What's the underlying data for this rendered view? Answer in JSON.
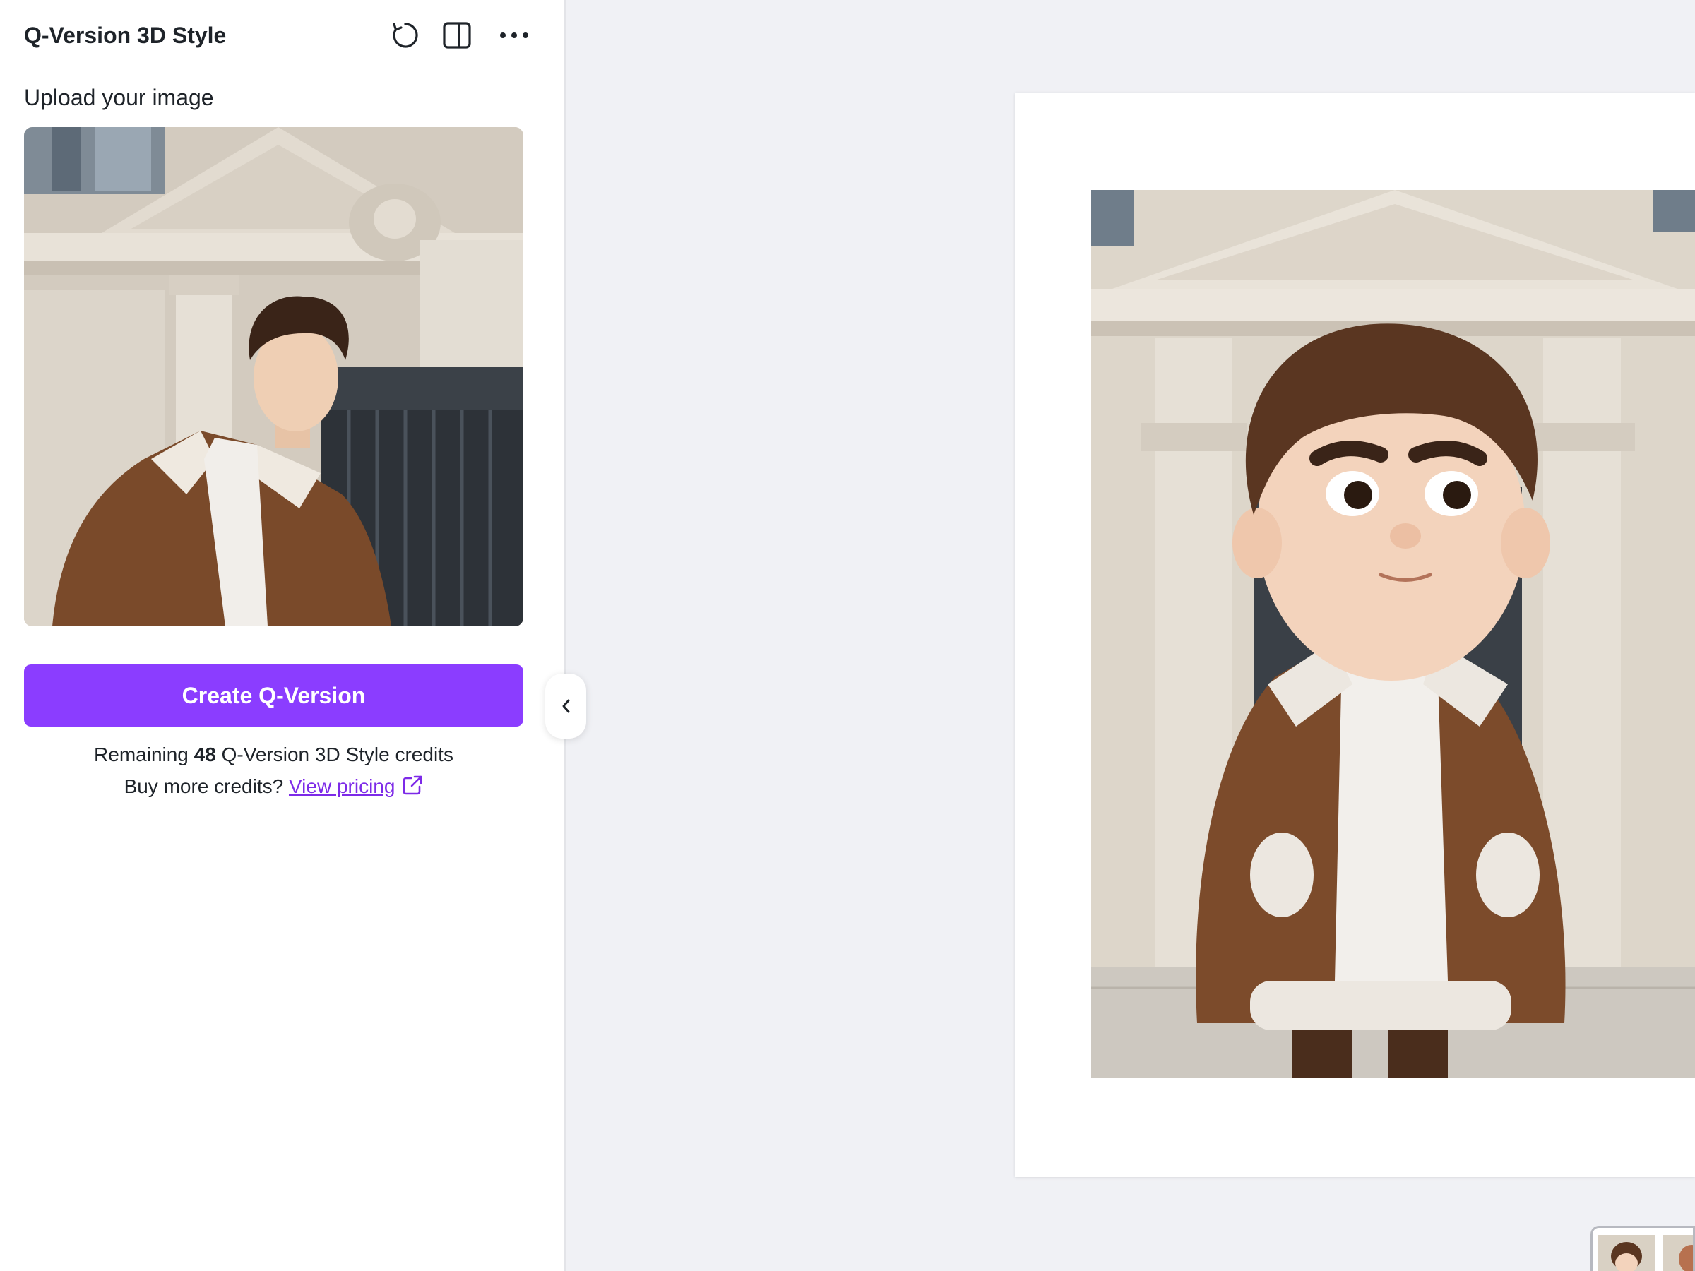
{
  "panel": {
    "title": "Q-Version 3D Style",
    "header_icons": [
      "refresh-icon",
      "split-view-icon",
      "more-options-icon"
    ],
    "upload_label": "Upload your image",
    "uploaded_image_description_icon": "trash-icon",
    "create_button_label": "Create Q-Version",
    "credits": {
      "prefix": "Remaining",
      "count": "48",
      "suffix": "Q-Version 3D Style credits"
    },
    "pricing": {
      "question": "Buy more credits?",
      "link_label": "View pricing",
      "link_icon": "external-link-icon"
    }
  },
  "collapse_icon": "chevron-left-icon",
  "colors": {
    "accent": "#8b3dff",
    "link": "#7d2ae8",
    "panel_bg": "#ffffff",
    "canvas_bg": "#f0f1f5",
    "text": "#1e2329"
  }
}
